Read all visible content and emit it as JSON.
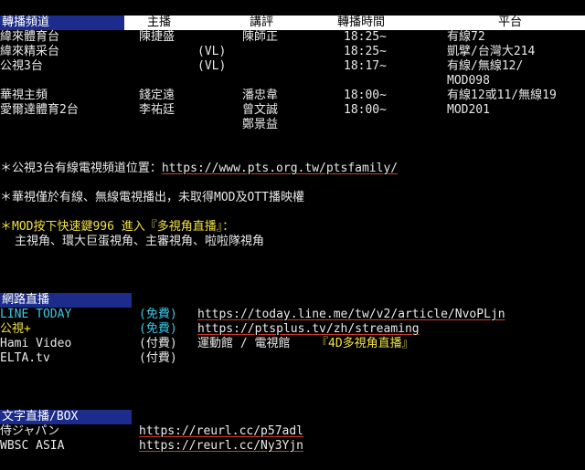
{
  "broadcast": {
    "header": {
      "title": "轉播頻道",
      "anchor": "主播",
      "commentator": "講評",
      "time": "轉播時間",
      "platform": "平台"
    },
    "rows": [
      {
        "channel": "緯來體育台",
        "anchor": "陳捷盛",
        "commentator": "陳師正",
        "time": "18:25~",
        "platform": "有線72"
      },
      {
        "channel": "緯來精采台",
        "anchor": "(VL)",
        "commentator": "",
        "time": "18:25~",
        "platform": "凱擘/台灣大214"
      },
      {
        "channel": "公視3台",
        "anchor": "(VL)",
        "commentator": "",
        "time": "18:17~",
        "platform": "有線/無線12/"
      },
      {
        "channel": "",
        "anchor": "",
        "commentator": "",
        "time": "",
        "platform": "MOD098"
      },
      {
        "channel": "華視主頻",
        "anchor": "錢定遠",
        "commentator": "潘忠韋",
        "time": "18:00~",
        "platform": "有線12或11/無線19"
      },
      {
        "channel": "愛爾達體育2台",
        "anchor": "李祐廷",
        "commentator": "曾文誠",
        "time": "18:00~",
        "platform": "MOD201"
      },
      {
        "channel": "",
        "anchor": "",
        "commentator": "鄭景益",
        "time": "",
        "platform": ""
      }
    ]
  },
  "notes": {
    "pts3_prefix": "＊公視3台有線電視頻道位置：",
    "pts3_url": "https://www.pts.org.tw/ptsfamily/",
    "cts": "＊華視僅於有線、無線電視播出，未取得MOD及OTT播映權",
    "mod_line1": "＊MOD按下快速鍵996  進入『多視角直播』：",
    "mod_line2": "主視角、環大巨蛋視角、主審視角、啦啦隊視角"
  },
  "online": {
    "title": "網路直播",
    "rows": [
      {
        "name": "LINE TODAY",
        "fee": "(免費)",
        "url": "https://today.line.me/tw/v2/article/NvoPLjn",
        "extra": ""
      },
      {
        "name": "公視+",
        "fee": "(免費)",
        "url": "https://ptsplus.tv/zh/streaming",
        "extra": ""
      },
      {
        "name": "Hami Video",
        "fee": "(付費)",
        "url": "運動館 / 電視館",
        "extra": "『4D多視角直播』"
      },
      {
        "name": "ELTA.tv",
        "fee": "(付費)",
        "url": "",
        "extra": ""
      }
    ]
  },
  "text_live": {
    "title": "文字直播/BOX",
    "rows": [
      {
        "name": "侍ジャパン",
        "url": "https://reurl.cc/p57adl"
      },
      {
        "name": "WBSC ASIA",
        "url": "https://reurl.cc/Ny3Yjn"
      }
    ]
  },
  "colors": {
    "background": "#000000",
    "header_blue": "#1c2c8c",
    "cyan": "#3cc8e8",
    "yellow": "#f0e040",
    "link_underline": "#d23a2a"
  }
}
